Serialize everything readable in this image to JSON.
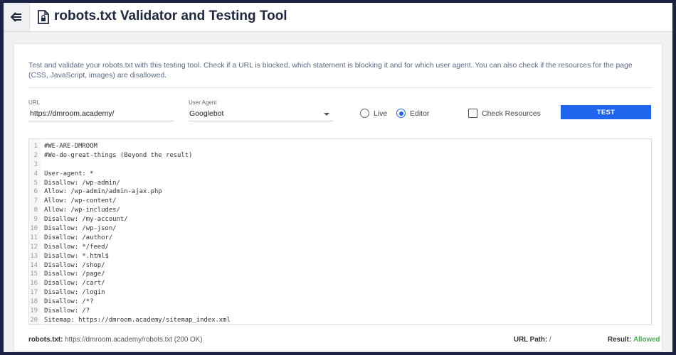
{
  "header": {
    "title": "robots.txt Validator and Testing Tool",
    "back_icon": "back-arrow-icon",
    "title_icon": "file-lock-icon"
  },
  "description": "Test and validate your robots.txt with this testing tool. Check if a URL is blocked, which statement is blocking it and for which user agent. You can also check if the resources for the page (CSS, JavaScript, images) are disallowed.",
  "form": {
    "url_label": "URL",
    "url_value": "https://dmroom.academy/",
    "user_agent_label": "User Agent",
    "user_agent_value": "Googlebot",
    "mode_live_label": "Live",
    "mode_editor_label": "Editor",
    "selected_mode": "editor",
    "check_resources_label": "Check Resources",
    "check_resources_checked": false,
    "test_button_label": "TEST"
  },
  "editor": {
    "lines": [
      {
        "num": "1",
        "text": "#WE-ARE-DMROOM"
      },
      {
        "num": "2",
        "text": "#We-do-great-things (Beyond the result)"
      },
      {
        "num": "3",
        "text": ""
      },
      {
        "num": "4",
        "text": "User-agent: *"
      },
      {
        "num": "5",
        "text": "Disallow: /wp-admin/"
      },
      {
        "num": "6",
        "text": "Allow: /wp-admin/admin-ajax.php"
      },
      {
        "num": "7",
        "text": "Allow: /wp-content/"
      },
      {
        "num": "8",
        "text": "Allow: /wp-includes/"
      },
      {
        "num": "9",
        "text": "Disallow: /my-account/"
      },
      {
        "num": "10",
        "text": "Disallow: /wp-json/"
      },
      {
        "num": "11",
        "text": "Disallow: /author/"
      },
      {
        "num": "12",
        "text": "Disallow: */feed/"
      },
      {
        "num": "13",
        "text": "Disallow: *.html$"
      },
      {
        "num": "14",
        "text": "Disallow: /shop/"
      },
      {
        "num": "15",
        "text": "Disallow: /page/"
      },
      {
        "num": "16",
        "text": "Disallow: /cart/"
      },
      {
        "num": "17",
        "text": "Disallow: /login"
      },
      {
        "num": "18",
        "text": "Disallow: /*?"
      },
      {
        "num": "19",
        "text": "Disallow: /?"
      },
      {
        "num": "20",
        "text": "Sitemap: https://dmroom.academy/sitemap_index.xml"
      }
    ]
  },
  "footer": {
    "robots_label": "robots.txt:",
    "robots_value": "https://dmroom.academy/robots.txt (200 OK)",
    "url_path_label": "URL Path:",
    "url_path_value": "/",
    "result_label": "Result:",
    "result_value": "Allowed"
  },
  "colors": {
    "accent": "#1e64ec",
    "allowed": "#4caf50",
    "background_frame": "#1b2244",
    "title": "#1f2740"
  }
}
